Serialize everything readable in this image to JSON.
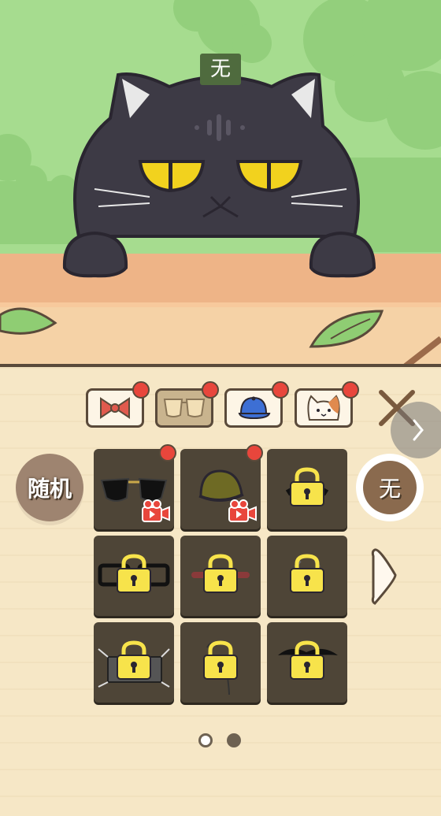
{
  "cat": {
    "name_label": "无"
  },
  "category_tabs": [
    {
      "name": "bow",
      "active": false,
      "badge": true
    },
    {
      "name": "glasses",
      "active": true,
      "badge": true
    },
    {
      "name": "cap",
      "active": false,
      "badge": true
    },
    {
      "name": "cat-face",
      "active": false,
      "badge": true
    }
  ],
  "buttons": {
    "random_label": "随机",
    "none_label": "无"
  },
  "items": [
    {
      "name": "sunglasses",
      "locked": false,
      "video": true,
      "badge": true
    },
    {
      "name": "olive-hat",
      "locked": false,
      "video": true,
      "badge": true
    },
    {
      "name": "item-3",
      "locked": true
    },
    {
      "name": "black-frame-glasses",
      "locked": true
    },
    {
      "name": "item-5",
      "locked": true
    },
    {
      "name": "item-6",
      "locked": true
    },
    {
      "name": "mask",
      "locked": true
    },
    {
      "name": "item-8",
      "locked": true
    },
    {
      "name": "mustache",
      "locked": true
    }
  ],
  "pagination": {
    "current": 2,
    "total": 2
  },
  "colors": {
    "badge": "#e8463c",
    "lock": "#f7e34b",
    "cell": "#4e4537",
    "panel": "#f6e7c6"
  }
}
